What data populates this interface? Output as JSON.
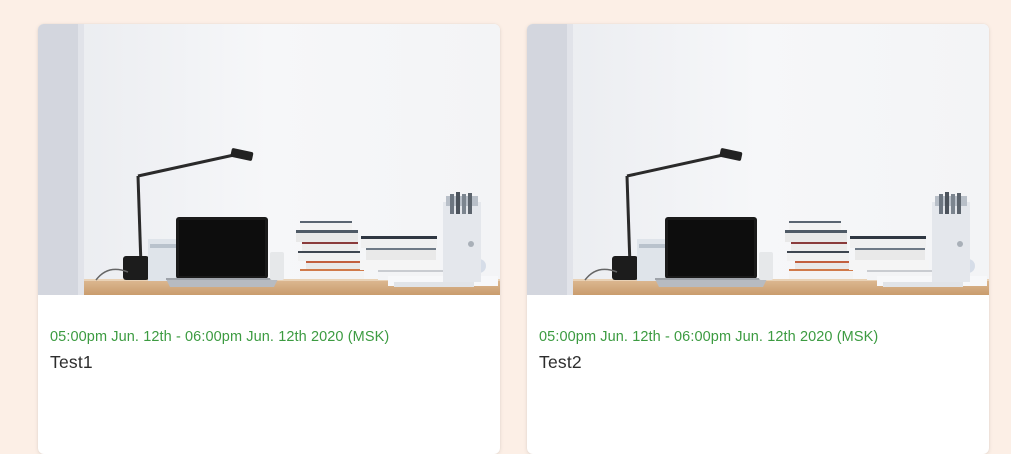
{
  "cards": [
    {
      "date_range": "05:00pm Jun. 12th - 06:00pm Jun. 12th 2020 (MSK)",
      "title": "Test1",
      "image": "desk-workspace-photo"
    },
    {
      "date_range": "05:00pm Jun. 12th - 06:00pm Jun. 12th 2020 (MSK)",
      "title": "Test2",
      "image": "desk-workspace-photo"
    }
  ],
  "colors": {
    "page_background": "#fcefe6",
    "date_text": "#3c9b41",
    "title_text": "#2d2d2d",
    "card_background": "#ffffff"
  }
}
